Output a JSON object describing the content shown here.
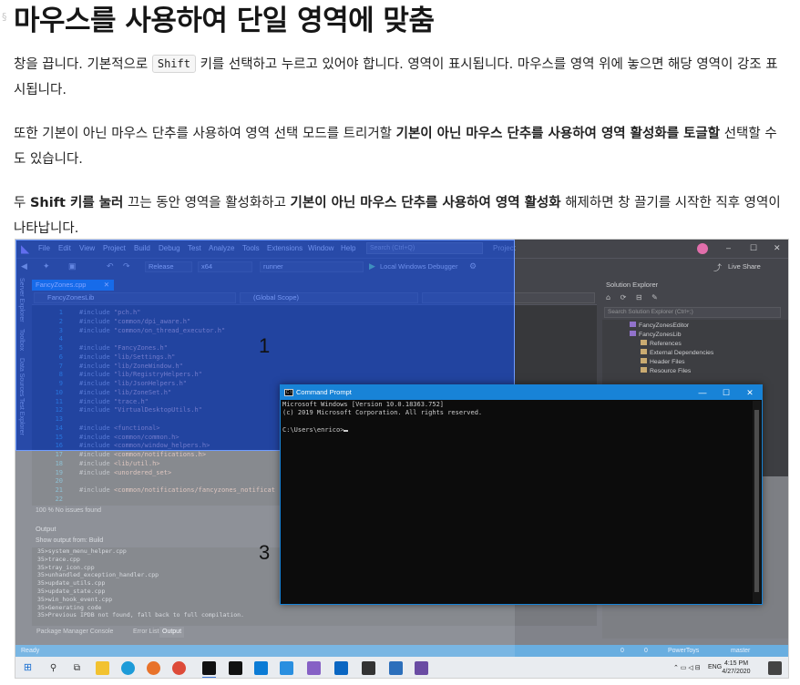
{
  "article": {
    "title": "마우스를 사용하여 단일 영역에 맞춤",
    "p1_before": "창을 끕니다. 기본적으로 ",
    "p1_key": "Shift",
    "p1_after": " 키를 선택하고 누르고 있어야 합니다. 영역이 표시됩니다. 마우스를 영역 위에 놓으면 해당 영역이 강조 표시됩니다.",
    "p2_before": "또한 기본이 아닌 마우스 단추를 사용하여 영역 선택 모드를 트리거할 ",
    "p2_bold": "기본이 아닌 마우스 단추를 사용하여 영역 활성화를 토글할",
    "p2_after": " 선택할 수도 있습니다.",
    "p3_a": "두 ",
    "p3_bold1": "Shift 키를 눌러",
    "p3_b": " 끄는 동안 영역을 활성화하고 ",
    "p3_bold2": "기본이 아닌 마우스 단추를 사용하여 영역 활성화",
    "p3_c": " 해제하면 창 끌기를 시작한 직후 영역이 나타납니다."
  },
  "vs": {
    "menu": [
      "File",
      "Edit",
      "View",
      "Project",
      "Build",
      "Debug",
      "Test",
      "Analyze",
      "Tools",
      "Extensions",
      "Window",
      "Help"
    ],
    "search_placeholder": "Search (Ctrl+Q)",
    "project_name": "Project",
    "toolbar": {
      "config": "Release",
      "platform": "x64",
      "startup": "runner",
      "debugger": "Local Windows Debugger",
      "live_share": "Live Share"
    },
    "side_tabs": [
      "Server Explorer",
      "Toolbox",
      "Data Sources",
      "Test Explorer"
    ],
    "editor_tab": "FancyZones.cpp",
    "nav_project": "FancyZonesLib",
    "nav_scope": "(Global Scope)",
    "code": [
      {
        "ln": "1",
        "pre": "#include ",
        "str": "\"pch.h\""
      },
      {
        "ln": "2",
        "pre": "#include ",
        "str": "\"common/dpi_aware.h\""
      },
      {
        "ln": "3",
        "pre": "#include ",
        "str": "\"common/on_thread_executor.h\""
      },
      {
        "ln": "4",
        "pre": "",
        "str": ""
      },
      {
        "ln": "5",
        "pre": "#include ",
        "str": "\"FancyZones.h\""
      },
      {
        "ln": "6",
        "pre": "#include ",
        "str": "\"lib/Settings.h\""
      },
      {
        "ln": "7",
        "pre": "#include ",
        "str": "\"lib/ZoneWindow.h\""
      },
      {
        "ln": "8",
        "pre": "#include ",
        "str": "\"lib/RegistryHelpers.h\""
      },
      {
        "ln": "9",
        "pre": "#include ",
        "str": "\"lib/JsonHelpers.h\""
      },
      {
        "ln": "10",
        "pre": "#include ",
        "str": "\"lib/ZoneSet.h\""
      },
      {
        "ln": "11",
        "pre": "#include ",
        "str": "\"trace.h\""
      },
      {
        "ln": "12",
        "pre": "#include ",
        "str": "\"VirtualDesktopUtils.h\""
      },
      {
        "ln": "13",
        "pre": "",
        "str": ""
      },
      {
        "ln": "14",
        "pre": "#include ",
        "str": "<functional>"
      },
      {
        "ln": "15",
        "pre": "#include ",
        "str": "<common/common.h>"
      },
      {
        "ln": "16",
        "pre": "#include ",
        "str": "<common/window_helpers.h>"
      },
      {
        "ln": "17",
        "pre": "#include ",
        "str": "<common/notifications.h>"
      },
      {
        "ln": "18",
        "pre": "#include ",
        "str": "<lib/util.h>"
      },
      {
        "ln": "19",
        "pre": "#include ",
        "str": "<unordered_set>"
      },
      {
        "ln": "20",
        "pre": "",
        "str": ""
      },
      {
        "ln": "21",
        "pre": "#include ",
        "str": "<common/notifications/fancyzones_notificat"
      },
      {
        "ln": "22",
        "pre": "",
        "str": ""
      }
    ],
    "editor_status": "100 %    No issues found",
    "output_title": "Output",
    "output_source": "Show output from:  Build",
    "output_lines": [
      "35>system_menu_helper.cpp",
      "35>trace.cpp",
      "35>tray_icon.cpp",
      "35>unhandled_exception_handler.cpp",
      "35>update_utils.cpp",
      "35>update_state.cpp",
      "35>win_hook_event.cpp",
      "35>Generating code",
      "35>Previous IPDB not found, fall back to full compilation."
    ],
    "output_tabs": [
      "Package Manager Console",
      "Error List",
      "Output"
    ],
    "solution_title": "Solution Explorer",
    "solution_search": "Search Solution Explorer (Ctrl+;)",
    "solution_items": [
      {
        "label": "FancyZonesEditor",
        "kind": "proj"
      },
      {
        "label": "FancyZonesLib",
        "kind": "proj"
      },
      {
        "label": "References",
        "kind": "folder"
      },
      {
        "label": "External Dependencies",
        "kind": "folder"
      },
      {
        "label": "Header Files",
        "kind": "folder"
      },
      {
        "label": "Resource Files",
        "kind": "folder"
      }
    ],
    "status": {
      "ready": "Ready",
      "errors": "0",
      "warnings": "0",
      "repo": "PowerToys",
      "branch": "master"
    }
  },
  "zones": {
    "label_1": "1",
    "label_3": "3"
  },
  "cmd": {
    "title": "Command Prompt",
    "line1": "Microsoft Windows [Version 10.0.18363.752]",
    "line2": "(c) 2019 Microsoft Corporation. All rights reserved.",
    "prompt": "C:\\Users\\enrico>"
  },
  "taskbar": {
    "lang": "ENG",
    "time": "4:15 PM",
    "date": "4/27/2020"
  }
}
